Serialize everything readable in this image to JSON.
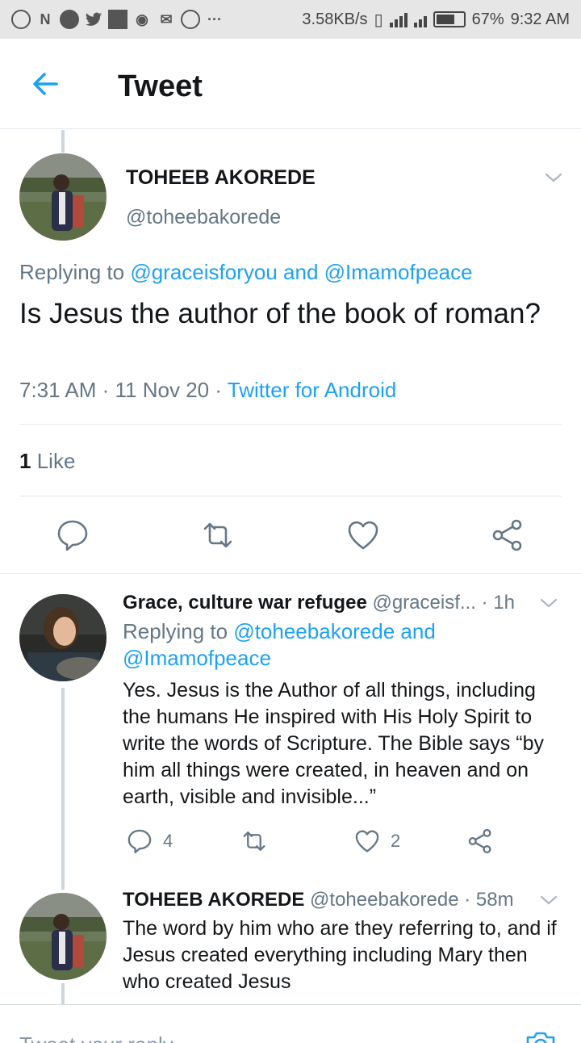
{
  "status_bar": {
    "speed": "3.58KB/s",
    "battery": "67%",
    "time": "9:32 AM"
  },
  "header": {
    "title": "Tweet"
  },
  "main_tweet": {
    "author_name": "TOHEEB AKOREDE",
    "author_handle": "@toheebakorede",
    "replying_prefix": "Replying to",
    "replying_user1": "@graceisforyou",
    "replying_and": "and",
    "replying_user2": "@Imamofpeace",
    "text": "Is Jesus the author of the book of roman?",
    "time": "7:31 AM",
    "date": "11 Nov 20",
    "source": "Twitter for Android",
    "like_count": "1",
    "like_label": "Like"
  },
  "replies": [
    {
      "name": "Grace, culture war refugee",
      "handle": "@graceisf...",
      "time": "1h",
      "replying_prefix": "Replying to",
      "replying_to": "@toheebakorede and @Imamofpeace",
      "text": "Yes. Jesus is the Author of all things, including the humans He inspired with His Holy Spirit to write the words of Scripture.  The Bible says “by him all things were created, in heaven and on earth, visible and invisible...”",
      "reply_count": "4",
      "like_count": "2"
    },
    {
      "name": "TOHEEB AKOREDE",
      "handle": "@toheebakorede",
      "time": "58m",
      "text": "The word by him who are they referring to, and if Jesus created everything including Mary then who created Jesus"
    }
  ],
  "compose": {
    "placeholder": "Tweet your reply"
  },
  "colors": {
    "accent": "#1da1f2",
    "secondary_text": "#657786",
    "divider": "#e1e8ed"
  },
  "icons": [
    "back-arrow-icon",
    "chevron-down-icon",
    "reply-icon",
    "retweet-icon",
    "like-icon",
    "share-icon",
    "camera-icon"
  ]
}
